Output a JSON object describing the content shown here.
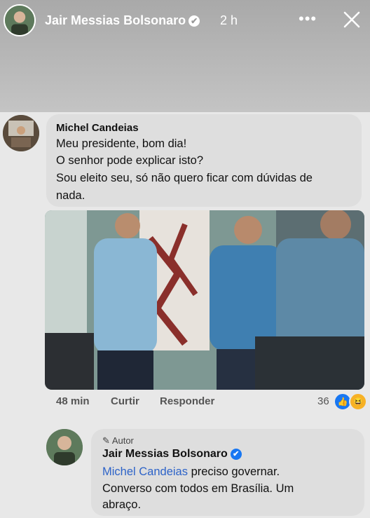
{
  "story": {
    "author_name": "Jair Messias Bolsonaro",
    "time": "2 h",
    "more_icon": "more-dots-icon",
    "close_icon": "close-icon",
    "verified_icon": "verified-check-icon"
  },
  "comment": {
    "author_name": "Michel Candeias",
    "lines": [
      "Meu presidente, bom dia!",
      "O senhor pode explicar isto?",
      "Sou eleito seu, só não quero ficar com dúvidas de",
      "nada."
    ],
    "time": "48 min",
    "like_label": "Curtir",
    "reply_label": "Responder",
    "reaction_count": "36",
    "reaction_icons": [
      "like-icon",
      "haha-icon"
    ]
  },
  "reply": {
    "author_tag": "Autor",
    "author_name": "Jair Messias Bolsonaro",
    "mention": "Michel Candeias",
    "line1_rest": " preciso governar.",
    "line2": "Converso com todos em Brasília. Um",
    "line3": "abraço."
  }
}
